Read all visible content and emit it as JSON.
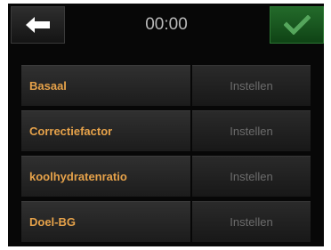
{
  "header": {
    "back_icon": "arrow-left-icon",
    "time": "00:00",
    "confirm_icon": "checkmark-icon"
  },
  "settings": [
    {
      "label": "Basaal",
      "action": "Instellen"
    },
    {
      "label": "Correctiefactor",
      "action": "Instellen"
    },
    {
      "label": "koolhydratenratio",
      "action": "Instellen"
    },
    {
      "label": "Doel-BG",
      "action": "Instellen"
    }
  ],
  "colors": {
    "label_text": "#e6a24a",
    "action_text": "#6c6c6c",
    "confirm_bg": "#1c5a22",
    "confirm_icon": "#55a65c",
    "background": "#070707"
  }
}
